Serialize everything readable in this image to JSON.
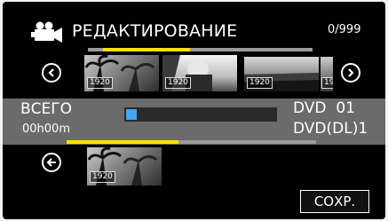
{
  "header": {
    "title": "РЕДАКТИРОВАНИЕ",
    "counter": "0/999",
    "icon": "movie-camera-icon"
  },
  "thumbnails": {
    "badges": [
      "1920",
      "1920",
      "1920",
      "19"
    ],
    "prev_icon": "chevron-left-circle-icon",
    "next_icon": "chevron-right-circle-icon"
  },
  "info": {
    "total_label": "ВСЕГО",
    "total_time": "00h00m",
    "disc_line1": "DVD  01",
    "disc_line2": "DVD(DL)1",
    "progress_fraction": 0.07
  },
  "selected": {
    "badges": [
      "1920"
    ],
    "back_icon": "back-arrow-circle-icon"
  },
  "footer": {
    "save_label": "СОХР."
  },
  "colors": {
    "background": "#000000",
    "highlight_yellow": "#ffe100",
    "strip_gray": "#6b6b6b",
    "progress_blue": "#3fa9f5"
  }
}
